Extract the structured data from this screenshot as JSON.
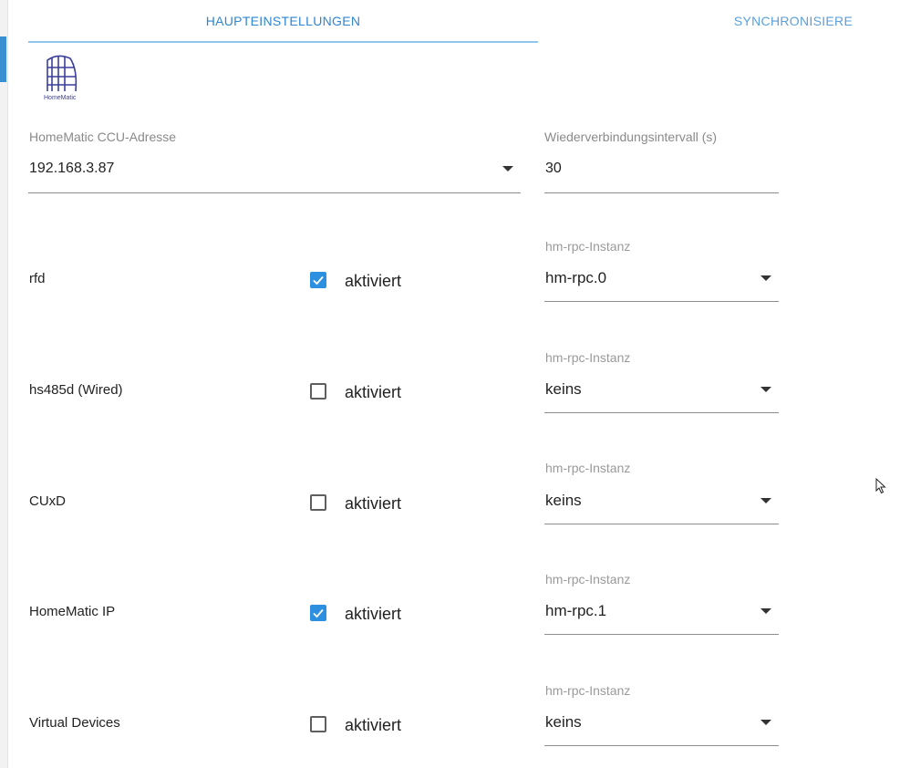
{
  "tabs": [
    {
      "label": "HAUPTEINSTELLUNGEN",
      "active": true
    },
    {
      "label": "SYNCHRONISIERE",
      "active": false
    }
  ],
  "logo": {
    "text": "HomeMatic",
    "icon": "homematic-logo-icon"
  },
  "ccu_address": {
    "label": "HomeMatic CCU-Adresse",
    "value": "192.168.3.87"
  },
  "reconnect_interval": {
    "label": "Wiederverbindungsintervall (s)",
    "value": "30"
  },
  "daemons": [
    {
      "name": "rfd",
      "enabled": true,
      "checkbox_label": "aktiviert",
      "instance_label": "hm-rpc-Instanz",
      "instance": "hm-rpc.0"
    },
    {
      "name": "hs485d (Wired)",
      "enabled": false,
      "checkbox_label": "aktiviert",
      "instance_label": "hm-rpc-Instanz",
      "instance": "keins"
    },
    {
      "name": "CUxD",
      "enabled": false,
      "checkbox_label": "aktiviert",
      "instance_label": "hm-rpc-Instanz",
      "instance": "keins"
    },
    {
      "name": "HomeMatic IP",
      "enabled": true,
      "checkbox_label": "aktiviert",
      "instance_label": "hm-rpc-Instanz",
      "instance": "hm-rpc.1"
    },
    {
      "name": "Virtual Devices",
      "enabled": false,
      "checkbox_label": "aktiviert",
      "instance_label": "hm-rpc-Instanz",
      "instance": "keins"
    }
  ],
  "colors": {
    "accent": "#2d8fe0",
    "tab_text": "#2f86d2",
    "indicator": "#8fc6ee"
  }
}
